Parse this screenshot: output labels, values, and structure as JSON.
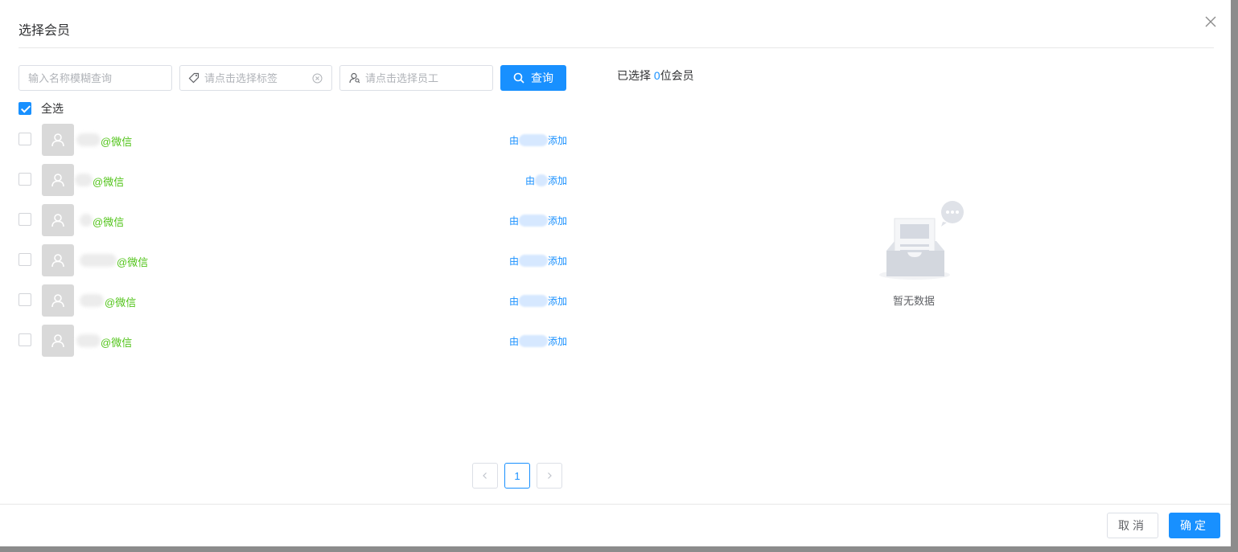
{
  "dialog": {
    "title": "选择会员",
    "cancel_label": "取消",
    "ok_label": "确定"
  },
  "filters": {
    "name_placeholder": "输入名称模糊查询",
    "tag_placeholder": "请点击选择标签",
    "staff_placeholder": "请点击选择员工",
    "query_label": "查询"
  },
  "select_all": {
    "label": "全选",
    "checked": true
  },
  "selected": {
    "prefix": "已选择 ",
    "count": "0",
    "suffix": "位会员"
  },
  "members": [
    {
      "name": "@微信",
      "added_prefix": "由",
      "added_suffix": "添加"
    },
    {
      "name": "@微信",
      "added_prefix": "由",
      "added_suffix": "添加"
    },
    {
      "name": "@微信",
      "added_prefix": "由",
      "added_suffix": "添加"
    },
    {
      "name": "@微信",
      "added_prefix": "由",
      "added_suffix": "添加"
    },
    {
      "name": "@微信",
      "added_prefix": "由",
      "added_suffix": "添加"
    },
    {
      "name": "@微信",
      "added_prefix": "由",
      "added_suffix": "添加"
    }
  ],
  "pagination": {
    "current": "1"
  },
  "empty": {
    "text": "暂无数据"
  },
  "colors": {
    "primary": "#1890ff",
    "wechat_green": "#52c41a"
  }
}
